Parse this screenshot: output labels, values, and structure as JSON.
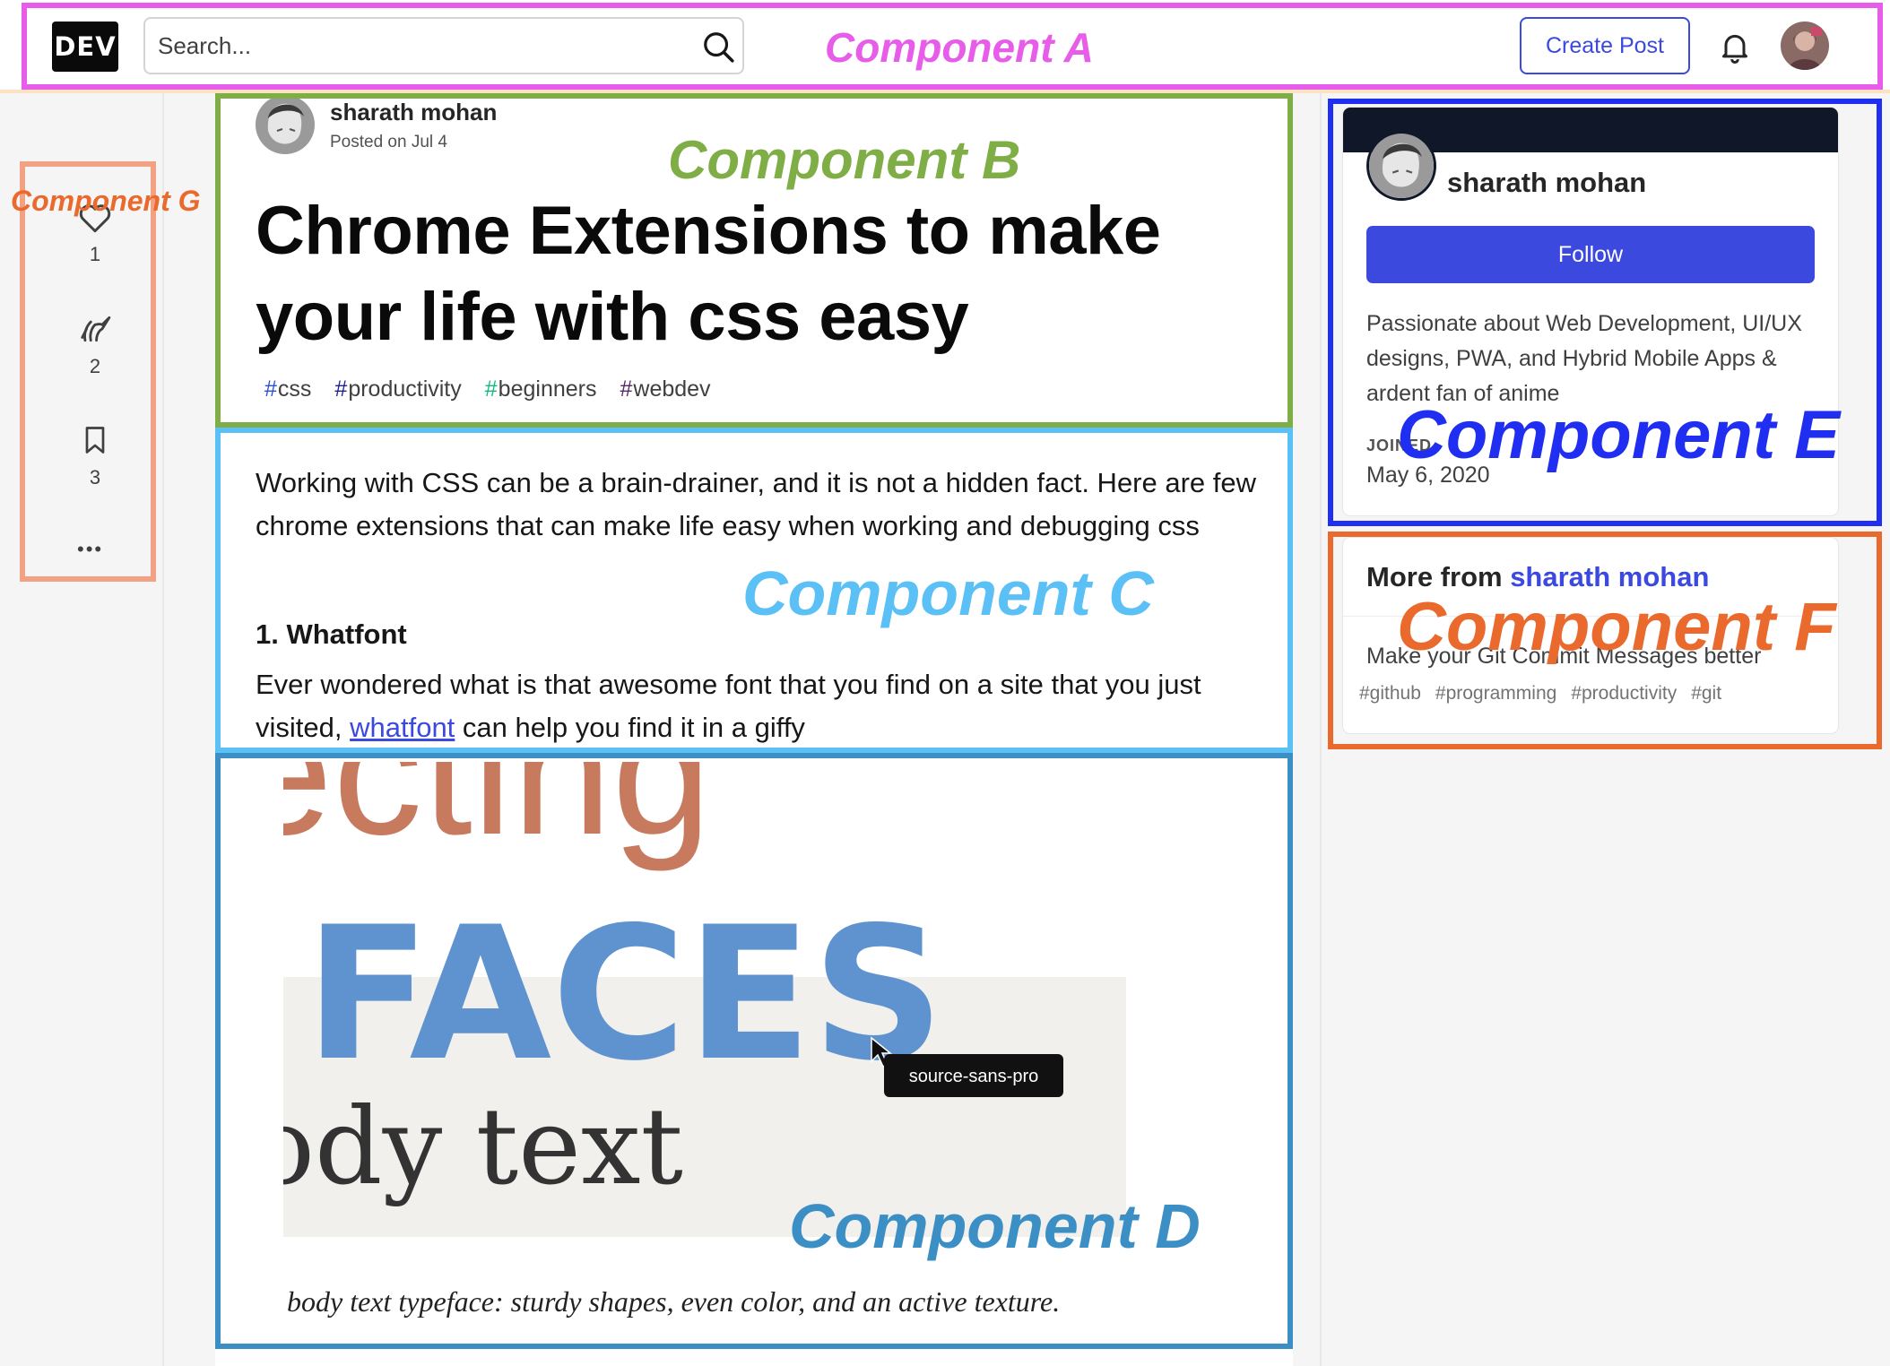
{
  "header": {
    "logo_text": "DEV",
    "search_placeholder": "Search...",
    "create_post_label": "Create Post"
  },
  "reactions": [
    {
      "icon": "heart-icon",
      "count": "1"
    },
    {
      "icon": "unicorn-icon",
      "count": "2"
    },
    {
      "icon": "bookmark-icon",
      "count": "3"
    }
  ],
  "reactions_more": "•••",
  "article": {
    "author_name": "sharath mohan",
    "posted_on": "Posted on Jul 4",
    "title_line1": "Chrome Extensions to make",
    "title_line2": "your life with css easy",
    "tags": [
      {
        "hash": "#",
        "name": "css",
        "hash_color": "#2a4fd6"
      },
      {
        "hash": "#",
        "name": "productivity",
        "hash_color": "#1f1f8f"
      },
      {
        "hash": "#",
        "name": "beginners",
        "hash_color": "#10b981"
      },
      {
        "hash": "#",
        "name": "webdev",
        "hash_color": "#562765"
      }
    ],
    "intro": "Working with CSS can be a brain-drainer, and it is not a hidden fact. Here are few chrome extensions that can make life easy when working and debugging css",
    "section_heading": "1. Whatfont",
    "section_body_before": "Ever wondered what is that awesome font that you find on a site that you just visited, ",
    "section_link": "whatfont",
    "section_body_after": " can help you find it in a giffy"
  },
  "post_image": {
    "top_word": "ecting",
    "big_word": "FACES",
    "body_word": "ody text",
    "tooltip": "source-sans-pro",
    "caption": "body text typeface: sturdy shapes, even color, and an active texture."
  },
  "profile": {
    "name": "sharath mohan",
    "follow_label": "Follow",
    "bio": "Passionate about Web Development, UI/UX designs, PWA, and Hybrid Mobile Apps & ardent fan of anime",
    "joined_label": "JOINED",
    "joined_date": "May 6, 2020"
  },
  "more_from": {
    "prefix": "More from ",
    "author": "sharath mohan",
    "post_title": "Make your Git Commit Messages better",
    "tags": [
      "#github",
      "#programming",
      "#productivity",
      "#git"
    ]
  },
  "annotations": [
    {
      "id": "A",
      "label": "Component A",
      "color": "#e75ce9"
    },
    {
      "id": "B",
      "label": "Component B",
      "color": "#7fae47"
    },
    {
      "id": "C",
      "label": "Component C",
      "color": "#5bc0f5"
    },
    {
      "id": "D",
      "label": "Component D",
      "color": "#3b8fc5"
    },
    {
      "id": "E",
      "label": "Component E",
      "color": "#1f2ef0"
    },
    {
      "id": "F",
      "label": "Component F",
      "color": "#ea6a2e"
    },
    {
      "id": "G",
      "label": "Component G",
      "color": "#f2a283"
    }
  ]
}
